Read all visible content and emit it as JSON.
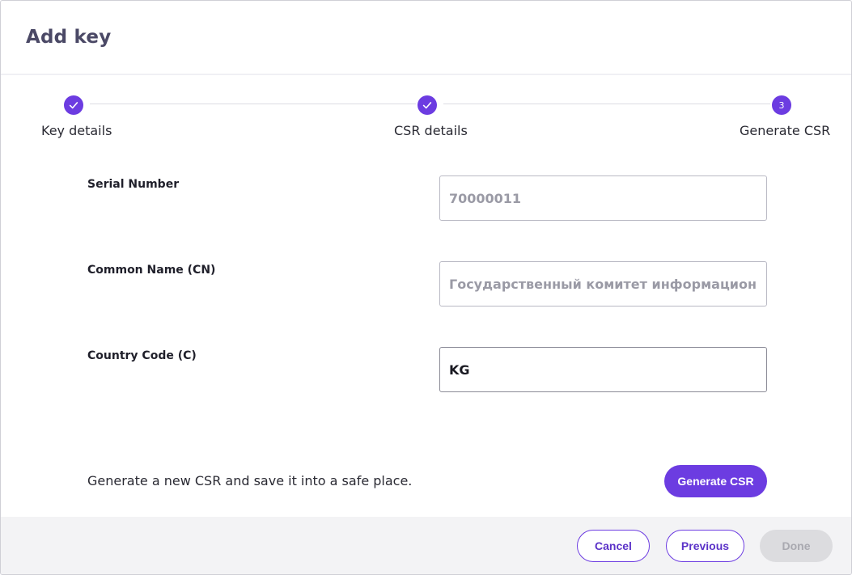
{
  "dialog": {
    "title": "Add key"
  },
  "stepper": {
    "steps": [
      {
        "label": "Key details",
        "state": "completed",
        "icon": "check-icon"
      },
      {
        "label": "CSR details",
        "state": "completed",
        "icon": "check-icon"
      },
      {
        "label": "Generate CSR",
        "state": "current",
        "number": "3"
      }
    ]
  },
  "form": {
    "fields": [
      {
        "label": "Serial Number",
        "value": "70000011",
        "disabled": true
      },
      {
        "label": "Common Name (CN)",
        "value": "Государственный комитет информационных",
        "disabled": true
      },
      {
        "label": "Country Code (C)",
        "value": "KG",
        "disabled": false
      }
    ],
    "hint": "Generate a new CSR and save it into a safe place.",
    "generate_label": "Generate CSR"
  },
  "footer": {
    "cancel_label": "Cancel",
    "previous_label": "Previous",
    "done_label": "Done"
  },
  "colors": {
    "accent": "#6c3ce1",
    "title": "#4b4966",
    "footer_bg": "#f3f3f5",
    "disabled_button": "#dcdcdf"
  }
}
